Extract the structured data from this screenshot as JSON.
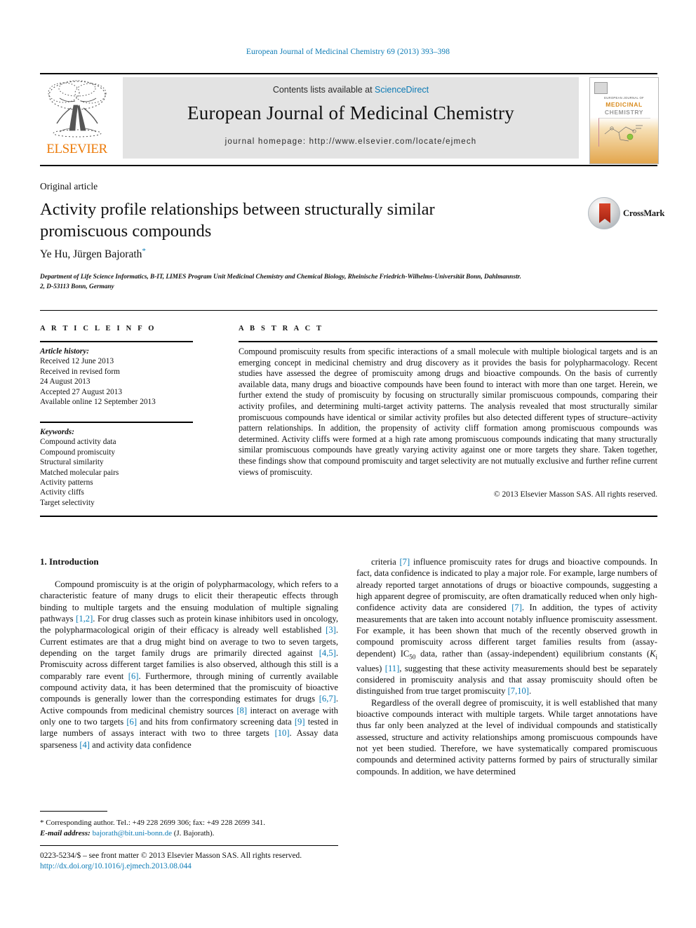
{
  "running_head": "European Journal of Medicinal Chemistry 69 (2013) 393–398",
  "masthead": {
    "contents_prefix": "Contents lists available at ",
    "sciencedirect": "ScienceDirect",
    "journal_title": "European Journal of Medicinal Chemistry",
    "homepage": "journal homepage: http://www.elsevier.com/locate/ejmech",
    "publisher": "ELSEVIER",
    "cover": {
      "line1": "EUROPEAN JOURNAL OF",
      "line2": "MEDICINAL",
      "line3": "CHEMISTRY"
    }
  },
  "article": {
    "kind": "Original article",
    "title": "Activity profile relationships between structurally similar promiscuous compounds",
    "authors": "Ye Hu, Jürgen Bajorath",
    "affiliation": "Department of Life Science Informatics, B-IT, LIMES Program Unit Medicinal Chemistry and Chemical Biology, Rheinische Friedrich-Wilhelms-Universität Bonn, Dahlmannstr. 2, D-53113 Bonn, Germany",
    "crossmark_label": "CrossMark"
  },
  "article_info": {
    "heading": "A R T I C L E   I N F O",
    "history_label": "Article history:",
    "history": [
      "Received 12 June 2013",
      "Received in revised form",
      "24 August 2013",
      "Accepted 27 August 2013",
      "Available online 12 September 2013"
    ],
    "keywords_label": "Keywords:",
    "keywords": [
      "Compound activity data",
      "Compound promiscuity",
      "Structural similarity",
      "Matched molecular pairs",
      "Activity patterns",
      "Activity cliffs",
      "Target selectivity"
    ]
  },
  "abstract": {
    "heading": "A B S T R A C T",
    "text": "Compound promiscuity results from specific interactions of a small molecule with multiple biological targets and is an emerging concept in medicinal chemistry and drug discovery as it provides the basis for polypharmacology. Recent studies have assessed the degree of promiscuity among drugs and bioactive compounds. On the basis of currently available data, many drugs and bioactive compounds have been found to interact with more than one target. Herein, we further extend the study of promiscuity by focusing on structurally similar promiscuous compounds, comparing their activity profiles, and determining multi-target activity patterns. The analysis revealed that most structurally similar promiscuous compounds have identical or similar activity profiles but also detected different types of structure–activity pattern relationships. In addition, the propensity of activity cliff formation among promiscuous compounds was determined. Activity cliffs were formed at a high rate among promiscuous compounds indicating that many structurally similar promiscuous compounds have greatly varying activity against one or more targets they share. Taken together, these findings show that compound promiscuity and target selectivity are not mutually exclusive and further refine current views of promiscuity.",
    "copyright": "© 2013 Elsevier Masson SAS. All rights reserved."
  },
  "body": {
    "intro_heading": "1. Introduction",
    "left_paragraph": "Compound promiscuity is at the origin of polypharmacology, which refers to a characteristic feature of many drugs to elicit their therapeutic effects through binding to multiple targets and the ensuing modulation of multiple signaling pathways [1,2]. For drug classes such as protein kinase inhibitors used in oncology, the polypharmacological origin of their efficacy is already well established [3]. Current estimates are that a drug might bind on average to two to seven targets, depending on the target family drugs are primarily directed against [4,5]. Promiscuity across different target families is also observed, although this still is a comparably rare event [6]. Furthermore, through mining of currently available compound activity data, it has been determined that the promiscuity of bioactive compounds is generally lower than the corresponding estimates for drugs [6,7]. Active compounds from medicinal chemistry sources [8] interact on average with only one to two targets [6] and hits from confirmatory screening data [9] tested in large numbers of assays interact with two to three targets [10]. Assay data sparseness [4] and activity data confidence",
    "right_paragraph_1": "criteria [7] influence promiscuity rates for drugs and bioactive compounds. In fact, data confidence is indicated to play a major role. For example, large numbers of already reported target annotations of drugs or bioactive compounds, suggesting a high apparent degree of promiscuity, are often dramatically reduced when only high-confidence activity data are considered [7]. In addition, the types of activity measurements that are taken into account notably influence promiscuity assessment. For example, it has been shown that much of the recently observed growth in compound promiscuity across different target families results from (assay-dependent) IC50 data, rather than (assay-independent) equilibrium constants (Ki values) [11], suggesting that these activity measurements should best be separately considered in promiscuity analysis and that assay promiscuity should often be distinguished from true target promiscuity [7,10].",
    "right_paragraph_2": "Regardless of the overall degree of promiscuity, it is well established that many bioactive compounds interact with multiple targets. While target annotations have thus far only been analyzed at the level of individual compounds and statistically assessed, structure and activity relationships among promiscuous compounds have not yet been studied. Therefore, we have systematically compared promiscuous compounds and determined activity patterns formed by pairs of structurally similar compounds. In addition, we have determined"
  },
  "footnote": {
    "marker": "*",
    "text": "Corresponding author. Tel.: +49 228 2699 306; fax: +49 228 2699 341.",
    "email_label": "E-mail address:",
    "email": "bajorath@bit.uni-bonn.de",
    "email_suffix": "(J. Bajorath)."
  },
  "footer": {
    "issn_line": "0223-5234/$ – see front matter © 2013 Elsevier Masson SAS. All rights reserved.",
    "doi": "http://dx.doi.org/10.1016/j.ejmech.2013.08.044"
  },
  "colors": {
    "link_blue": "#0b7ab5",
    "elsevier_orange": "#ec7b0a",
    "band_gray": "#e3e3e3"
  }
}
